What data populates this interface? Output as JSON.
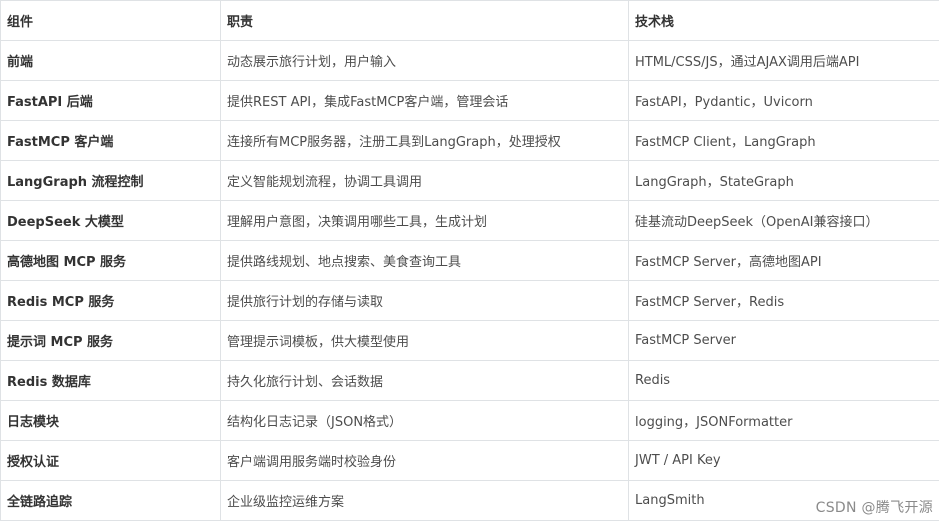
{
  "table": {
    "headers": [
      "组件",
      "职责",
      "技术栈"
    ],
    "rows": [
      [
        "前端",
        "动态展示旅行计划，用户输入",
        "HTML/CSS/JS，通过AJAX调用后端API"
      ],
      [
        "FastAPI 后端",
        "提供REST API，集成FastMCP客户端，管理会话",
        "FastAPI，Pydantic，Uvicorn"
      ],
      [
        "FastMCP 客户端",
        "连接所有MCP服务器，注册工具到LangGraph，处理授权",
        "FastMCP Client，LangGraph"
      ],
      [
        "LangGraph 流程控制",
        "定义智能规划流程，协调工具调用",
        "LangGraph，StateGraph"
      ],
      [
        "DeepSeek 大模型",
        "理解用户意图，决策调用哪些工具，生成计划",
        "硅基流动DeepSeek（OpenAI兼容接口）"
      ],
      [
        "高德地图 MCP 服务",
        "提供路线规划、地点搜索、美食查询工具",
        "FastMCP Server，高德地图API"
      ],
      [
        "Redis MCP 服务",
        "提供旅行计划的存储与读取",
        "FastMCP Server，Redis"
      ],
      [
        "提示词 MCP 服务",
        "管理提示词模板，供大模型使用",
        "FastMCP Server"
      ],
      [
        "Redis 数据库",
        "持久化旅行计划、会话数据",
        "Redis"
      ],
      [
        "日志模块",
        "结构化日志记录（JSON格式）",
        "logging，JSONFormatter"
      ],
      [
        "授权认证",
        "客户端调用服务端时校验身份",
        "JWT / API Key"
      ],
      [
        "全链路追踪",
        "企业级监控运维方案",
        "LangSmith"
      ]
    ]
  },
  "watermark": "CSDN @腾飞开源"
}
